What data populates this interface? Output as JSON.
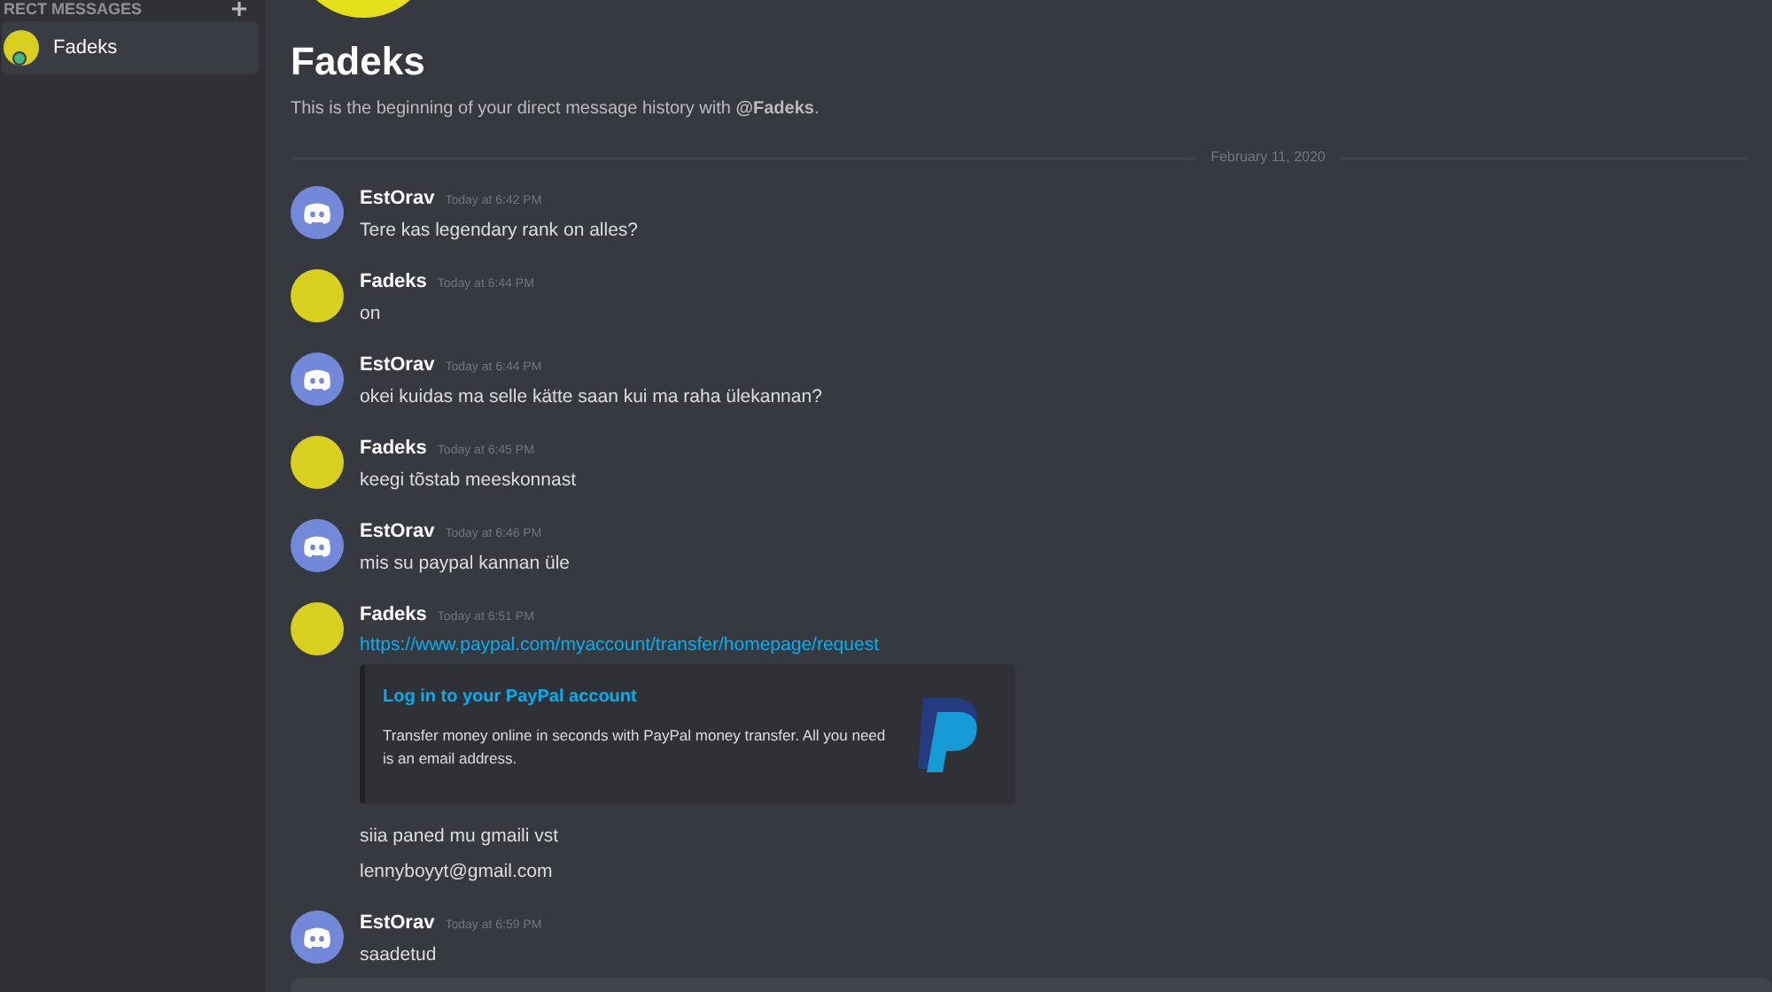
{
  "sidebar": {
    "section_title": "RECT MESSAGES",
    "items": [
      {
        "name": "Fadeks",
        "selected": true,
        "online": true
      }
    ]
  },
  "channel": {
    "title": "Fadeks",
    "intro": "This is the beginning of your direct message history with **@Fadeks**."
  },
  "date_divider": "February 11, 2020",
  "messages": [
    {
      "author": "EstOrav",
      "kind": "discord",
      "time": "Today at 6:42 PM",
      "content": [
        {
          "kind": "text",
          "text": "Tere kas legendary rank on alles?"
        }
      ]
    },
    {
      "author": "Fadeks",
      "kind": "picture",
      "time": "Today at 6:44 PM",
      "content": [
        {
          "kind": "text",
          "text": "on"
        }
      ]
    },
    {
      "author": "EstOrav",
      "kind": "discord",
      "time": "Today at 6:44 PM",
      "content": [
        {
          "kind": "text",
          "text": "okei kuidas ma selle kätte saan kui ma raha ülekannan?"
        }
      ]
    },
    {
      "author": "Fadeks",
      "kind": "picture",
      "time": "Today at 6:45 PM",
      "content": [
        {
          "kind": "text",
          "text": "keegi tõstab meeskonnast"
        }
      ]
    },
    {
      "author": "EstOrav",
      "kind": "discord",
      "time": "Today at 6:46 PM",
      "content": [
        {
          "kind": "text",
          "text": "mis su paypal kannan üle"
        }
      ]
    },
    {
      "author": "Fadeks",
      "kind": "picture",
      "time": "Today at 6:51 PM",
      "content": [
        {
          "kind": "link",
          "text": "https://www.paypal.com/myaccount/transfer/homepage/request"
        },
        {
          "kind": "embed",
          "title": "Log in to your PayPal account",
          "description": "Transfer money online in seconds with PayPal money transfer. All you need is an email address."
        },
        {
          "kind": "text",
          "text": "siia paned mu gmaili vst"
        },
        {
          "kind": "text",
          "text": "lennyboyyt@gmail.com"
        }
      ]
    },
    {
      "author": "EstOrav",
      "kind": "discord",
      "time": "Today at 6:59 PM",
      "content": [
        {
          "kind": "text",
          "text": "saadetud"
        }
      ]
    }
  ]
}
